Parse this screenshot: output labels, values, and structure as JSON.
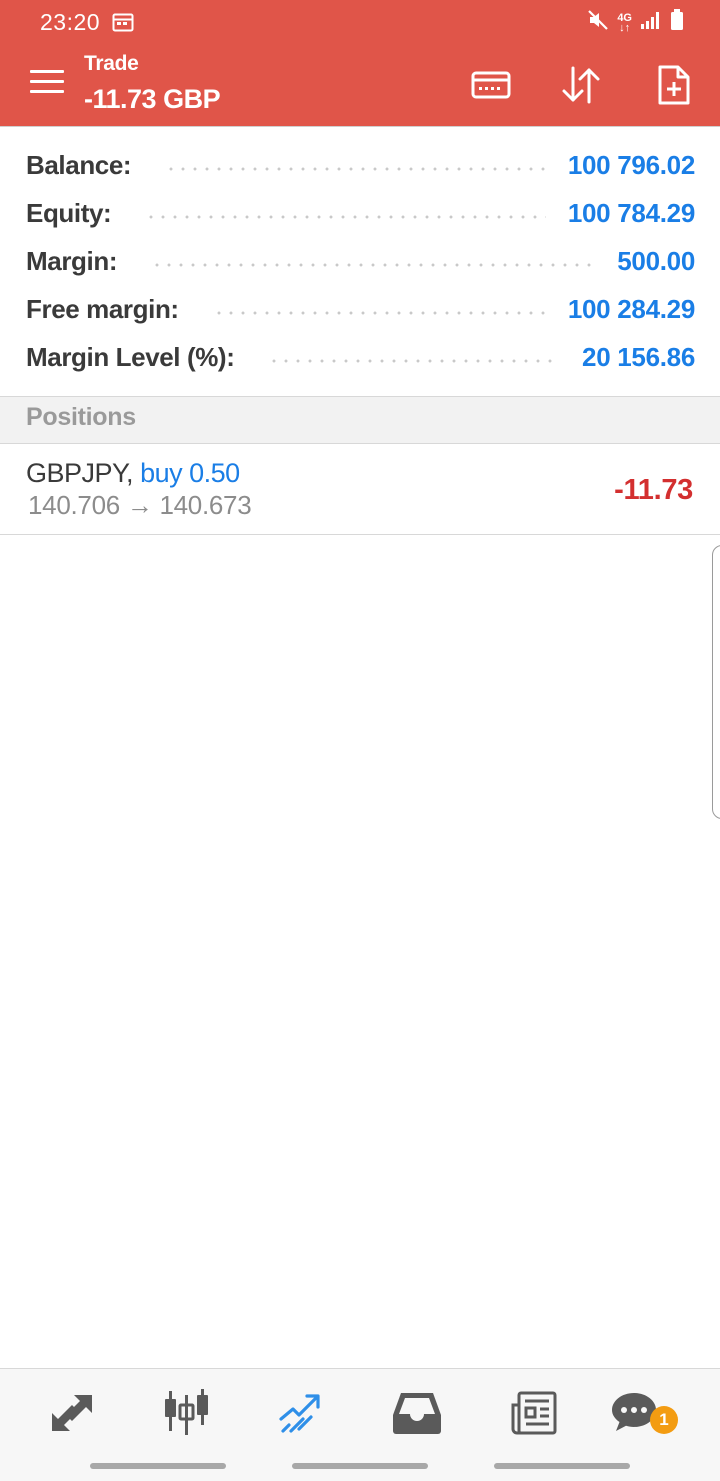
{
  "status_bar": {
    "time": "23:20",
    "network_label": "4G",
    "icons": [
      "calendar-icon",
      "mute-icon",
      "signal-icon",
      "battery-icon"
    ]
  },
  "app_bar": {
    "title": "Trade",
    "profit_summary": "-11.73 GBP",
    "icons": [
      "menu-icon",
      "deposit-card-icon",
      "sort-icon",
      "new-order-icon"
    ]
  },
  "account": {
    "rows": [
      {
        "label": "Balance:",
        "value": "100 796.02"
      },
      {
        "label": "Equity:",
        "value": "100 784.29"
      },
      {
        "label": "Margin:",
        "value": "500.00"
      },
      {
        "label": "Free margin:",
        "value": "100 284.29"
      },
      {
        "label": "Margin Level (%):",
        "value": "20 156.86"
      }
    ]
  },
  "positions": {
    "header": "Positions",
    "items": [
      {
        "symbol": "GBPJPY,",
        "side": "buy 0.50",
        "open_price": "140.706",
        "arrow": "→",
        "current_price": "140.673",
        "profit": "-11.73"
      }
    ]
  },
  "bottom_nav": {
    "items": [
      "quotes-icon",
      "chart-icon",
      "trade-icon",
      "history-icon",
      "news-icon",
      "messages-icon"
    ],
    "active": "trade-icon",
    "messages_badge": "1"
  },
  "colors": {
    "app_bar": "#e05549",
    "value_blue": "#1a7ee6",
    "loss_red": "#d32f2f",
    "badge_orange": "#f39c12"
  }
}
